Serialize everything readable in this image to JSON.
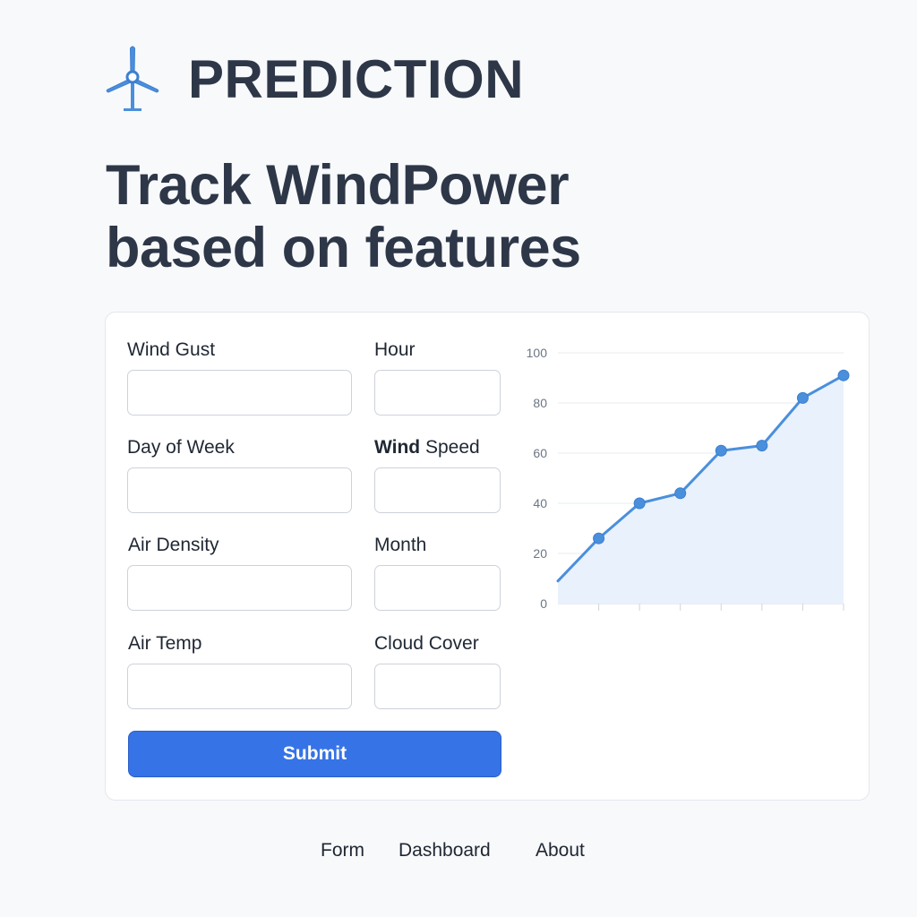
{
  "app": {
    "brand": "PREDICTION",
    "headline_line1": "Track WindPower",
    "headline_line2": "based on features",
    "logo_icon": "wind-turbine-icon",
    "accent_color": "#3673e6"
  },
  "form": {
    "fields": [
      {
        "id": "wind_gust",
        "label": "Wind Gust",
        "value": ""
      },
      {
        "id": "hour",
        "label": "Hour",
        "value": ""
      },
      {
        "id": "day_of_week",
        "label": "Day of Week",
        "value": ""
      },
      {
        "id": "wind_speed",
        "label_bold": "Wind",
        "label_rest": " Speed",
        "value": ""
      },
      {
        "id": "air_density",
        "label": "Air Density",
        "value": ""
      },
      {
        "id": "month",
        "label": "Month",
        "value": ""
      },
      {
        "id": "air_temp",
        "label": "Air Temp",
        "value": ""
      },
      {
        "id": "cloud_cover",
        "label": "Cloud Cover",
        "value": ""
      }
    ],
    "submit_label": "Submit"
  },
  "chart_data": {
    "type": "line",
    "title": "",
    "xlabel": "",
    "ylabel": "",
    "ylim": [
      0,
      100
    ],
    "yticks": [
      "0",
      "20",
      "40",
      "60",
      "80",
      "100"
    ],
    "grid": true,
    "series": [
      {
        "x": [
          0,
          1,
          2,
          3,
          4,
          5,
          6,
          7
        ],
        "values": [
          9,
          26,
          40,
          44,
          61,
          63,
          82,
          91
        ],
        "color": "#4a8fdc",
        "area_fill": "#e9f1fd"
      }
    ]
  },
  "nav": {
    "items": [
      {
        "label": "Form"
      },
      {
        "label": "Dashboard"
      },
      {
        "label": "About"
      }
    ]
  }
}
